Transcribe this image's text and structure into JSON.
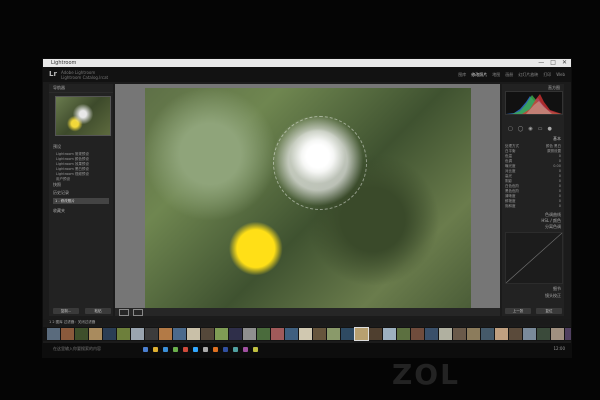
{
  "window": {
    "title_text": "Lightroom",
    "controls": [
      "—",
      "□",
      "✕"
    ]
  },
  "app": {
    "logo": "Lr",
    "catalog_line1": "Adobe Lightroom",
    "catalog_line2": "Lightroom Catalog.lrcat"
  },
  "modules": [
    "图库",
    "修改照片",
    "地图",
    "画册",
    "幻灯片放映",
    "打印",
    "Web"
  ],
  "left_panel": {
    "navigator_label": "导航器",
    "presets_label": "预设",
    "preset_items": [
      "Lightroom 常规预设",
      "Lightroom 颜色预设",
      "Lightroom 效果预设",
      "Lightroom 黑白预设",
      "Lightroom 视频预设",
      "用户预设"
    ],
    "snapshots_label": "快照",
    "history_label": "历史记录",
    "collections_label": "收藏夹",
    "selected_item": "1 - 修改照片",
    "copy_button": "复制...",
    "paste_button": "粘贴"
  },
  "right_panel": {
    "histogram_label": "直方图",
    "basic_label": "基本",
    "basic_rows": [
      [
        "处理方式",
        "颜色  黑白"
      ],
      [
        "白平衡",
        "原照设置"
      ],
      [
        "色温",
        "0"
      ],
      [
        "色调",
        "0"
      ],
      [
        "曝光度",
        "0.00"
      ],
      [
        "对比度",
        "0"
      ],
      [
        "高光",
        "0"
      ],
      [
        "阴影",
        "0"
      ],
      [
        "白色色阶",
        "0"
      ],
      [
        "黑色色阶",
        "0"
      ],
      [
        "清晰度",
        "0"
      ],
      [
        "鲜艳度",
        "0"
      ],
      [
        "饱和度",
        "0"
      ]
    ],
    "panels": [
      "色调曲线",
      "HSL / 颜色",
      "分离色调",
      "细节",
      "镜头校正"
    ],
    "previous_button": "上一张",
    "reset_button": "复位"
  },
  "filmstrip": {
    "info": "1  2  图库  过滤器：关闭过滤器",
    "thumb_colors": [
      "#5a6b7d",
      "#8a5a3c",
      "#3e4f2b",
      "#a98b5e",
      "#2a3d55",
      "#6d7f3b",
      "#9aa5b0",
      "#3c3c3c",
      "#b37a46",
      "#4b6a8c",
      "#c9c0a8",
      "#55483a",
      "#7f9c55",
      "#2f2f4a",
      "#8f8f8f",
      "#4a6b3c",
      "#a05a5a",
      "#3f5f7f",
      "#d0c8b0",
      "#66553c",
      "#8a9a6a",
      "#2e4a62",
      "#b8a070",
      "#4f3f2f",
      "#9db0c0",
      "#5c7040",
      "#704c3c",
      "#3a506a",
      "#b0b0a0",
      "#6a5a4a",
      "#8c7c5c",
      "#455a6a",
      "#c0a080",
      "#5a4a3a",
      "#7a8a9a",
      "#3a4a3a",
      "#a09080",
      "#504060",
      "#90a070",
      "#6a6a6a"
    ]
  },
  "taskbar": {
    "search_text": "在这里输入你要搜索的内容",
    "time": "12:00"
  },
  "watermark": "ZOL"
}
